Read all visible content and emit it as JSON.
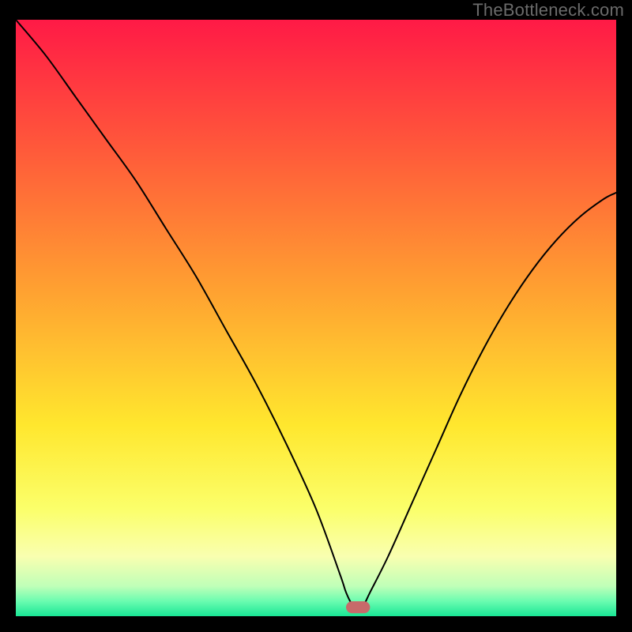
{
  "watermark": "TheBottleneck.com",
  "chart_data": {
    "type": "line",
    "title": "",
    "xlabel": "",
    "ylabel": "",
    "xlim": [
      0,
      100
    ],
    "ylim": [
      0,
      100
    ],
    "background": {
      "type": "vertical-gradient",
      "stops": [
        {
          "pos": 0.0,
          "color": "#FF1A46"
        },
        {
          "pos": 0.22,
          "color": "#FF5A3A"
        },
        {
          "pos": 0.45,
          "color": "#FFA031"
        },
        {
          "pos": 0.68,
          "color": "#FFE72E"
        },
        {
          "pos": 0.82,
          "color": "#FBFF6A"
        },
        {
          "pos": 0.9,
          "color": "#F9FFB0"
        },
        {
          "pos": 0.95,
          "color": "#BFFFB8"
        },
        {
          "pos": 0.975,
          "color": "#6AFCB0"
        },
        {
          "pos": 1.0,
          "color": "#19E695"
        }
      ]
    },
    "marker": {
      "x": 57,
      "y": 1.5,
      "width": 4,
      "height": 2,
      "color": "#C86A6A",
      "shape": "rounded-rect"
    },
    "series": [
      {
        "name": "bottleneck-curve",
        "color": "#000000",
        "stroke_width": 2,
        "x": [
          0,
          5,
          10,
          15,
          20,
          25,
          30,
          35,
          40,
          45,
          50,
          54,
          55,
          56,
          57,
          58,
          59,
          62,
          66,
          70,
          74,
          78,
          82,
          86,
          90,
          94,
          98,
          100
        ],
        "y": [
          100,
          94,
          87,
          80,
          73,
          65,
          57,
          48,
          39,
          29,
          18,
          7,
          4,
          2,
          1.3,
          2,
          4,
          10,
          19,
          28,
          37,
          45,
          52,
          58,
          63,
          67,
          70,
          71
        ]
      }
    ]
  }
}
